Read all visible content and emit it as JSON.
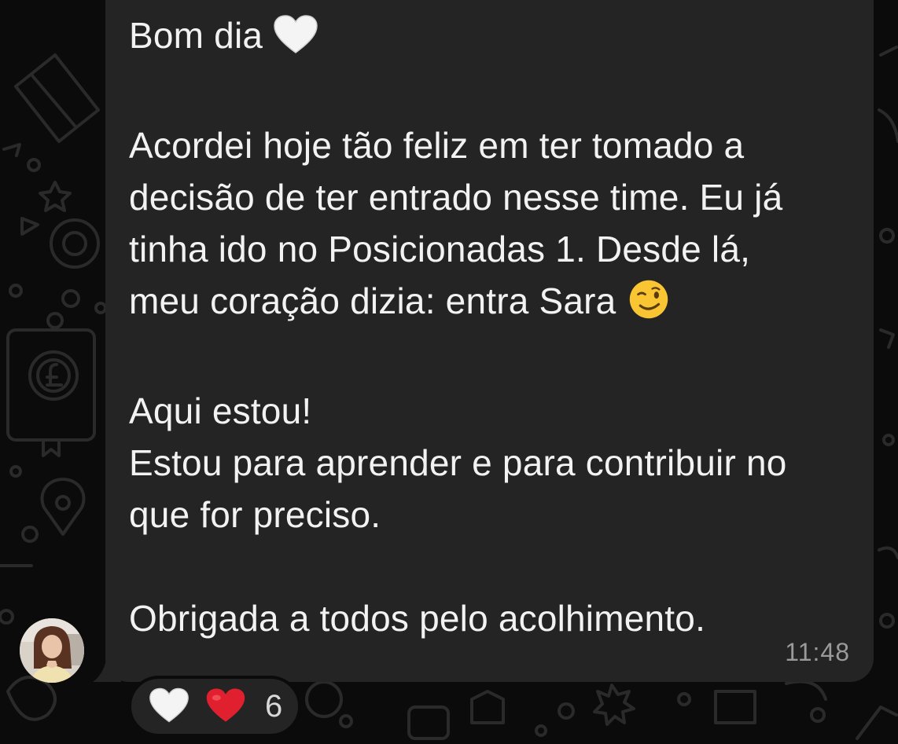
{
  "message": {
    "greeting": "Bom dia",
    "greeting_emoji": "white-heart",
    "paragraph1_line1": "Acordei hoje tão feliz em ter tomado a",
    "paragraph1_line2": "decisão de ter entrado nesse time. Eu já",
    "paragraph1_line3": "tinha ido no Posicionadas 1. Desde lá,",
    "paragraph1_line4": "meu coração dizia: entra Sara",
    "paragraph1_emoji": "winking-face",
    "paragraph2_line1": "Aqui estou!",
    "paragraph2_line2": "Estou para aprender e para contribuir no",
    "paragraph2_line3": "que for preciso.",
    "paragraph3_line1": "Obrigada a todos pelo acolhimento.",
    "time": "11:48"
  },
  "reactions": {
    "emojis": [
      "white-heart",
      "red-heart"
    ],
    "count": "6"
  },
  "colors": {
    "background": "#0b0b0b",
    "bubble": "#242424",
    "text": "#f2f2f2",
    "timestamp": "#9a9a9a",
    "heart_red": "#e0202e"
  }
}
